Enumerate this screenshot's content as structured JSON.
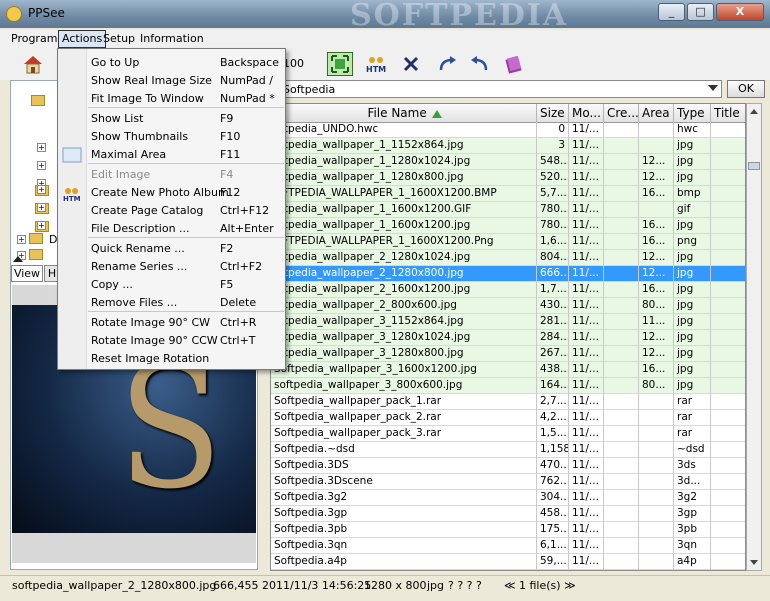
{
  "window": {
    "title": "PPSee",
    "watermark": "SOFTPEDIA",
    "min": "_",
    "max": "□",
    "close": "X"
  },
  "menu": {
    "items": [
      {
        "label": "Program"
      },
      {
        "label": "Actions"
      },
      {
        "label": "Setup"
      },
      {
        "label": "Information"
      }
    ],
    "active": "Actions"
  },
  "toolbar": {
    "zoom_value": "100",
    "icons": [
      "home-icon",
      "fit-area-icon",
      "html-album-icon",
      "delete-icon",
      "rotate-cw-icon",
      "rotate-ccw-icon",
      "book-icon"
    ]
  },
  "path": {
    "value": "Softpedia",
    "ok_label": "OK"
  },
  "left_pane": {
    "view_tab": "View",
    "tab2": "H",
    "tree_items": [
      "D"
    ]
  },
  "actions_menu": {
    "items": [
      {
        "label": "Go to Up",
        "shortcut": "Backspace",
        "disabled": false
      },
      {
        "label": "Show Real Image Size",
        "shortcut": "NumPad /",
        "disabled": false
      },
      {
        "label": "Fit Image To Window",
        "shortcut": "NumPad *",
        "disabled": false
      },
      {
        "label": "Show List",
        "shortcut": "F9",
        "disabled": false
      },
      {
        "label": "Show Thumbnails",
        "shortcut": "F10",
        "disabled": false
      },
      {
        "label": "Maximal Area",
        "shortcut": "F11",
        "disabled": false
      },
      {
        "label": "Edit Image",
        "shortcut": "F4",
        "disabled": true
      },
      {
        "label": "Create New Photo Album",
        "shortcut": "F12",
        "disabled": false
      },
      {
        "label": "Create Page Catalog",
        "shortcut": "Ctrl+F12",
        "disabled": false
      },
      {
        "label": "File Description ...",
        "shortcut": "Alt+Enter",
        "disabled": false
      },
      {
        "label": "Quick Rename ...",
        "shortcut": "F2",
        "disabled": false
      },
      {
        "label": "Rename Series ...",
        "shortcut": "Ctrl+F2",
        "disabled": false
      },
      {
        "label": "Copy ...",
        "shortcut": "F5",
        "disabled": false
      },
      {
        "label": "Remove Files ...",
        "shortcut": "Delete",
        "disabled": false
      },
      {
        "label": "Rotate Image 90° CW",
        "shortcut": "Ctrl+R",
        "disabled": false
      },
      {
        "label": "Rotate Image 90° CCW",
        "shortcut": "Ctrl+T",
        "disabled": false
      },
      {
        "label": "Reset Image Rotation",
        "shortcut": "",
        "disabled": false
      }
    ]
  },
  "table": {
    "columns": [
      "File Name",
      "Size",
      "Mo...",
      "Cre...",
      "Area",
      "Type",
      "Title"
    ],
    "rows": [
      {
        "name": "oftpedia_UNDO.hwc",
        "size": "0",
        "mod": "11/...",
        "area": "",
        "type": "hwc",
        "style": "w"
      },
      {
        "name": "oftpedia_wallpaper_1_1152x864.jpg",
        "size": "3",
        "mod": "11/...",
        "area": "",
        "type": "jpg",
        "style": "g"
      },
      {
        "name": "oftpedia_wallpaper_1_1280x1024.jpg",
        "size": "548...",
        "mod": "11/...",
        "area": "12...",
        "type": "jpg",
        "style": "g"
      },
      {
        "name": "oftpedia_wallpaper_1_1280x800.jpg",
        "size": "520...",
        "mod": "11/...",
        "area": "12...",
        "type": "jpg",
        "style": "g"
      },
      {
        "name": "OFTPEDIA_WALLPAPER_1_1600X1200.BMP",
        "size": "5,7...",
        "mod": "11/...",
        "area": "16...",
        "type": "bmp",
        "style": "g"
      },
      {
        "name": "oftpedia_wallpaper_1_1600x1200.GIF",
        "size": "780...",
        "mod": "11/...",
        "area": "",
        "type": "gif",
        "style": "g"
      },
      {
        "name": "oftpedia_wallpaper_1_1600x1200.jpg",
        "size": "780...",
        "mod": "11/...",
        "area": "16...",
        "type": "jpg",
        "style": "g"
      },
      {
        "name": "OFTPEDIA_WALLPAPER_1_1600X1200.Png",
        "size": "1,6...",
        "mod": "11/...",
        "area": "16...",
        "type": "png",
        "style": "g"
      },
      {
        "name": "oftpedia_wallpaper_2_1280x1024.jpg",
        "size": "804...",
        "mod": "11/...",
        "area": "12...",
        "type": "jpg",
        "style": "g"
      },
      {
        "name": "oftpedia_wallpaper_2_1280x800.jpg",
        "size": "666...",
        "mod": "11/...",
        "area": "12...",
        "type": "jpg",
        "style": "sel"
      },
      {
        "name": "oftpedia_wallpaper_2_1600x1200.jpg",
        "size": "1,7...",
        "mod": "11/...",
        "area": "16...",
        "type": "jpg",
        "style": "g"
      },
      {
        "name": "oftpedia_wallpaper_2_800x600.jpg",
        "size": "430...",
        "mod": "11/...",
        "area": "80...",
        "type": "jpg",
        "style": "g"
      },
      {
        "name": "oftpedia_wallpaper_3_1152x864.jpg",
        "size": "281...",
        "mod": "11/...",
        "area": "11...",
        "type": "jpg",
        "style": "g"
      },
      {
        "name": "oftpedia_wallpaper_3_1280x1024.jpg",
        "size": "284...",
        "mod": "11/...",
        "area": "12...",
        "type": "jpg",
        "style": "g"
      },
      {
        "name": "oftpedia_wallpaper_3_1280x800.jpg",
        "size": "267...",
        "mod": "11/...",
        "area": "12...",
        "type": "jpg",
        "style": "g"
      },
      {
        "name": "Softpedia_wallpaper_3_1600x1200.jpg",
        "size": "438...",
        "mod": "11/...",
        "area": "16...",
        "type": "jpg",
        "style": "g"
      },
      {
        "name": "softpedia_wallpaper_3_800x600.jpg",
        "size": "164...",
        "mod": "11/...",
        "area": "80...",
        "type": "jpg",
        "style": "g"
      },
      {
        "name": "Softpedia_wallpaper_pack_1.rar",
        "size": "2,7...",
        "mod": "11/...",
        "area": "",
        "type": "rar",
        "style": "w"
      },
      {
        "name": "Softpedia_wallpaper_pack_2.rar",
        "size": "4,2...",
        "mod": "11/...",
        "area": "",
        "type": "rar",
        "style": "w"
      },
      {
        "name": "Softpedia_wallpaper_pack_3.rar",
        "size": "1,5...",
        "mod": "11/...",
        "area": "",
        "type": "rar",
        "style": "w"
      },
      {
        "name": "Softpedia.~dsd",
        "size": "1,158",
        "mod": "11/...",
        "area": "",
        "type": "~dsd",
        "style": "w"
      },
      {
        "name": "Softpedia.3DS",
        "size": "470...",
        "mod": "11/...",
        "area": "",
        "type": "3ds",
        "style": "w"
      },
      {
        "name": "Softpedia.3Dscene",
        "size": "762...",
        "mod": "11/...",
        "area": "",
        "type": "3d...",
        "style": "w"
      },
      {
        "name": "Softpedia.3g2",
        "size": "304...",
        "mod": "11/...",
        "area": "",
        "type": "3g2",
        "style": "w"
      },
      {
        "name": "Softpedia.3gp",
        "size": "458...",
        "mod": "11/...",
        "area": "",
        "type": "3gp",
        "style": "w"
      },
      {
        "name": "Softpedia.3pb",
        "size": "175...",
        "mod": "11/...",
        "area": "",
        "type": "3pb",
        "style": "w"
      },
      {
        "name": "Softpedia.3qn",
        "size": "6,1...",
        "mod": "11/...",
        "area": "",
        "type": "3qn",
        "style": "w"
      },
      {
        "name": "Softpedia.a4p",
        "size": "59,...",
        "mod": "11/...",
        "area": "",
        "type": "a4p",
        "style": "w"
      }
    ]
  },
  "status": {
    "filename": "softpedia_wallpaper_2_1280x800.jpg",
    "size": "666,455",
    "datetime": "2011/11/3 14:56:25",
    "dims": "1280 x 800",
    "type": "jpg",
    "marks": "? ? ? ?",
    "count": "≪ 1 file(s) ≫"
  },
  "colors": {
    "selection": "#3399ff",
    "green_row": "#e8f8e4",
    "accent_toolbar": "#bfe7b0"
  }
}
